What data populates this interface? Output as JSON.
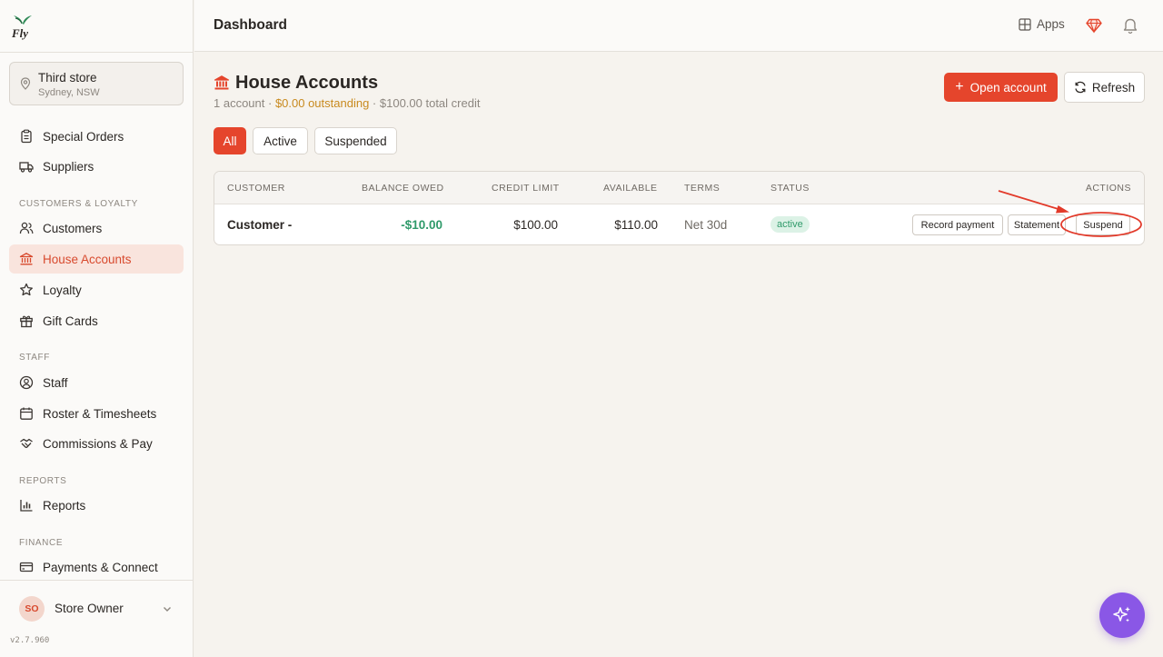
{
  "sidebar": {
    "logo_text": "Fly",
    "store": {
      "name": "Third store",
      "location": "Sydney, NSW"
    },
    "items": [
      {
        "label": "Special Orders",
        "icon": "clipboard-icon"
      },
      {
        "label": "Suppliers",
        "icon": "truck-icon"
      },
      {
        "label": "Customers",
        "icon": "users-icon"
      },
      {
        "label": "House Accounts",
        "icon": "bank-icon",
        "active": true
      },
      {
        "label": "Loyalty",
        "icon": "star-icon"
      },
      {
        "label": "Gift Cards",
        "icon": "gift-icon"
      },
      {
        "label": "Staff",
        "icon": "user-circle-icon"
      },
      {
        "label": "Roster & Timesheets",
        "icon": "calendar-icon"
      },
      {
        "label": "Commissions & Pay",
        "icon": "handshake-icon"
      },
      {
        "label": "Reports",
        "icon": "bar-chart-icon"
      },
      {
        "label": "Payments & Connect",
        "icon": "credit-card-icon"
      }
    ],
    "sections": {
      "customers": "CUSTOMERS & LOYALTY",
      "staff": "STAFF",
      "reports": "REPORTS",
      "finance": "FINANCE"
    },
    "user": {
      "initials": "SO",
      "name": "Store Owner"
    },
    "version": "v2.7.960"
  },
  "header": {
    "title": "Dashboard",
    "apps_label": "Apps"
  },
  "page": {
    "title": "House Accounts",
    "summary": {
      "count": "1 account",
      "sep": " · ",
      "outstanding": "$0.00 outstanding",
      "total_credit": "$100.00 total credit"
    },
    "open_account_label": "Open account",
    "refresh_label": "Refresh",
    "filters": [
      {
        "label": "All",
        "active": true
      },
      {
        "label": "Active",
        "active": false
      },
      {
        "label": "Suspended",
        "active": false
      }
    ]
  },
  "table": {
    "columns": [
      "CUSTOMER",
      "BALANCE OWED",
      "CREDIT LIMIT",
      "AVAILABLE",
      "TERMS",
      "STATUS",
      "ACTIONS"
    ],
    "rows": [
      {
        "customer": "Customer -",
        "balance_owed": "-$10.00",
        "credit_limit": "$100.00",
        "available": "$110.00",
        "terms": "Net 30d",
        "status": "active",
        "actions": [
          "Record payment",
          "Statement",
          "Suspend"
        ]
      }
    ]
  },
  "colors": {
    "accent": "#e5452c",
    "success": "#2f9a6a",
    "warning": "#c88a1f",
    "fab": "#8a57e6"
  },
  "fab_icon": "sparkles-icon"
}
